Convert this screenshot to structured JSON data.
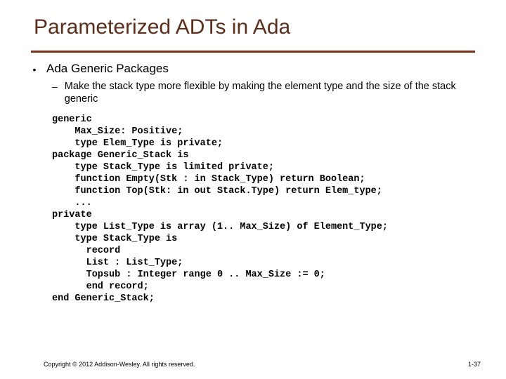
{
  "title": "Parameterized ADTs in Ada",
  "bullet1": "Ada Generic Packages",
  "bullet2": "Make the stack type more flexible by making the element type and the size of the stack generic",
  "code": "generic\n    Max_Size: Positive;\n    type Elem_Type is private;\npackage Generic_Stack is\n    type Stack_Type is limited private;\n    function Empty(Stk : in Stack_Type) return Boolean;\n    function Top(Stk: in out Stack.Type) return Elem_type;\n    ...\nprivate\n    type List_Type is array (1.. Max_Size) of Element_Type;\n    type Stack_Type is\n      record\n      List : List_Type;\n      Topsub : Integer range 0 .. Max_Size := 0;\n      end record;\nend Generic_Stack;",
  "footer_left": "Copyright © 2012 Addison-Wesley. All rights reserved.",
  "footer_right": "1-37"
}
